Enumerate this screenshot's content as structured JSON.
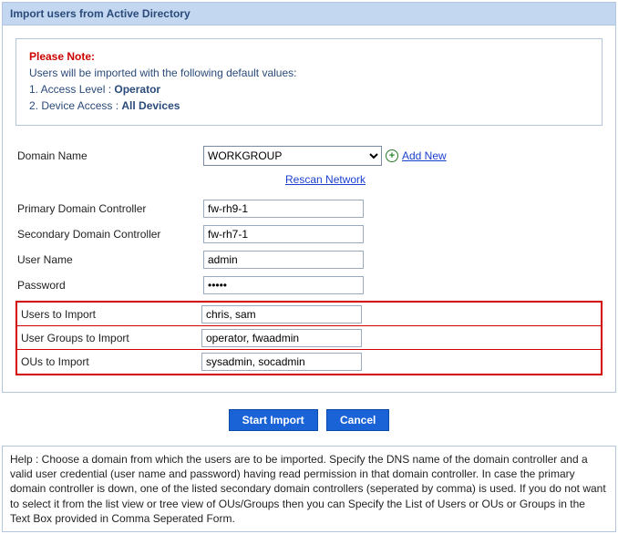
{
  "panel": {
    "title": "Import users from Active Directory"
  },
  "note": {
    "title": "Please Note:",
    "line_defaults": "Users will be imported with the following default values:",
    "line1_prefix": "1. Access Level : ",
    "line1_value": "Operator",
    "line2_prefix": "2. Device Access : ",
    "line2_value": "All Devices"
  },
  "form": {
    "domain_label": "Domain Name",
    "domain_value": "WORKGROUP",
    "add_new": "Add New",
    "rescan": "Rescan Network",
    "pdc_label": "Primary Domain Controller",
    "pdc_value": "fw-rh9-1",
    "sdc_label": "Secondary Domain Controller",
    "sdc_value": "fw-rh7-1",
    "user_label": "User Name",
    "user_value": "admin",
    "pass_label": "Password",
    "pass_value": "•••••",
    "users_import_label": "Users to Import",
    "users_import_value": "chris, sam",
    "groups_import_label": "User Groups to Import",
    "groups_import_value": "operator, fwaadmin",
    "ous_import_label": "OUs to Import",
    "ous_import_value": "sysadmin, socadmin"
  },
  "buttons": {
    "start": "Start Import",
    "cancel": "Cancel"
  },
  "help": {
    "text": "Help : Choose a domain from which the users are to be imported. Specify the DNS name of the domain controller and a valid user credential (user name and password) having read permission in that domain controller. In case the primary domain controller is down, one of the listed secondary domain controllers (seperated by comma) is used. If you do not want to select it from the list view or tree view of OUs/Groups then you can Specify the List of Users or OUs or Groups in the Text Box provided in Comma Seperated Form."
  }
}
